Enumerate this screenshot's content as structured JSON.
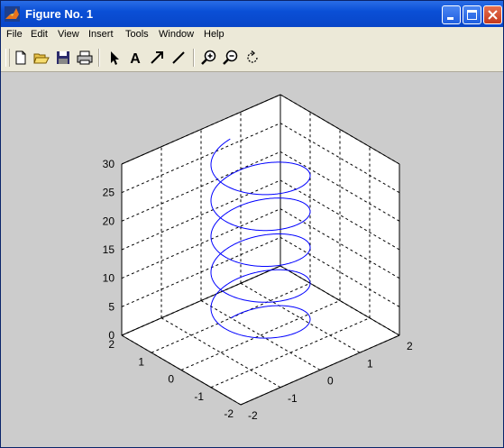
{
  "window": {
    "title": "Figure No. 1",
    "controls": [
      "minimize-icon",
      "maximize-icon",
      "close-icon"
    ]
  },
  "menu": [
    "File",
    "Edit",
    "View",
    "Insert",
    "Tools",
    "Window",
    "Help"
  ],
  "toolbar": {
    "tools": [
      "new-figure-icon",
      "open-file-icon",
      "save-icon",
      "print-icon",
      "edit-plot-arrow-icon",
      "insert-text-icon",
      "insert-arrow-icon",
      "insert-line-icon",
      "zoom-in-icon",
      "zoom-out-icon",
      "rotate-3d-icon"
    ],
    "text_tool_glyph": "A"
  },
  "chart_data": {
    "type": "line3d",
    "title": "",
    "xlabel": "",
    "ylabel": "",
    "zlabel": "",
    "xlim": [
      -2,
      2
    ],
    "ylim": [
      -2,
      2
    ],
    "zlim": [
      0,
      30
    ],
    "grid": true,
    "box": true,
    "x_ticks": [
      "-2",
      "-1",
      "0",
      "1",
      "2"
    ],
    "y_ticks": [
      "-2",
      "-1",
      "0",
      "1",
      "2"
    ],
    "z_ticks": [
      "0",
      "5",
      "10",
      "15",
      "20",
      "25",
      "30"
    ],
    "series": [
      {
        "color": "#0000ff",
        "description": "helix",
        "x_expr": "sin(t)",
        "y_expr": "cos(t)",
        "z_expr": "t",
        "t_range": [
          0,
          31.4
        ]
      }
    ],
    "colors": {
      "axes_bg": "#ffffff",
      "figure_bg": "#cccccc",
      "line": "#0000ff"
    }
  }
}
